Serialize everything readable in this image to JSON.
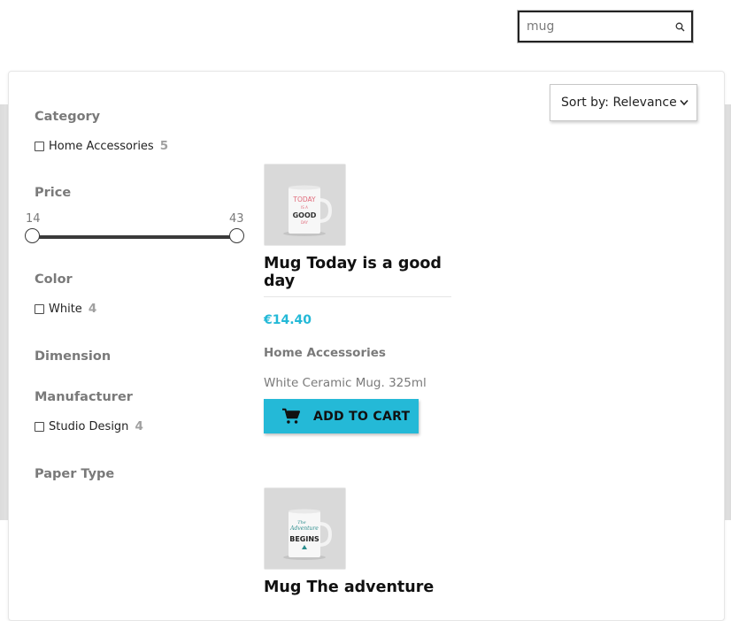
{
  "search": {
    "value": "mug",
    "icon": "search-icon"
  },
  "sort": {
    "label": "Sort by: Relevance"
  },
  "facets": {
    "category": {
      "title": "Category",
      "options": [
        {
          "label": "Home Accessories",
          "count": "5"
        }
      ]
    },
    "price": {
      "title": "Price",
      "min": "14",
      "max": "43"
    },
    "color": {
      "title": "Color",
      "options": [
        {
          "label": "White",
          "count": "4"
        }
      ]
    },
    "dimension": {
      "title": "Dimension"
    },
    "manufacturer": {
      "title": "Manufacturer",
      "options": [
        {
          "label": "Studio Design",
          "count": "4"
        }
      ]
    },
    "paper_type": {
      "title": "Paper Type"
    }
  },
  "products": [
    {
      "name": "Mug Today is a good day",
      "image_text": [
        "TODAY",
        "IS A",
        "GOOD",
        "DAY"
      ],
      "price": "€14.40",
      "category": "Home Accessories",
      "description": "White Ceramic Mug. 325ml",
      "cart_label": "ADD TO CART"
    },
    {
      "name": "Mug The adventure",
      "image_text": [
        "The",
        "Adventure",
        "BEGINS"
      ]
    }
  ],
  "colors": {
    "accent": "#24b9d7",
    "text_muted": "#7a7a7a",
    "text_dark": "#232323"
  }
}
